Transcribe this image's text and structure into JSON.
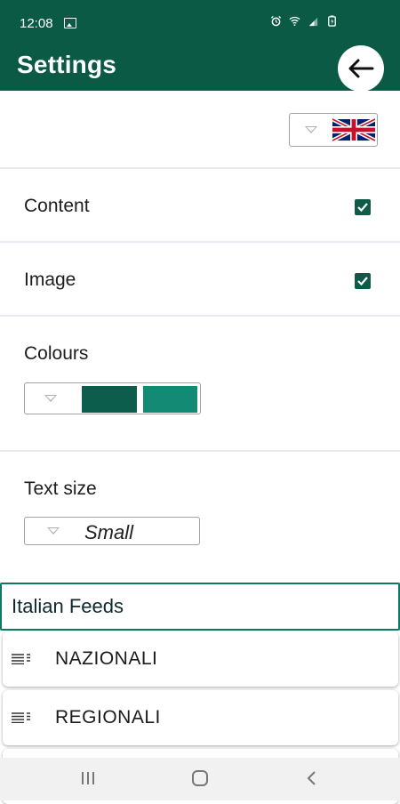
{
  "status_bar": {
    "time": "12:08",
    "icons": [
      "image-icon",
      "alarm-icon",
      "wifi-icon",
      "signal-icon",
      "battery-icon"
    ]
  },
  "app_bar": {
    "title": "Settings",
    "back_icon": "arrow-left-icon"
  },
  "language": {
    "selected_flag": "uk-flag"
  },
  "settings": {
    "content_label": "Content",
    "content_checked": true,
    "image_label": "Image",
    "image_checked": true,
    "colours_label": "Colours",
    "colours_selected": [
      "#0d5d4d",
      "#138a74"
    ],
    "text_size_label": "Text size",
    "text_size_value": "Small"
  },
  "feeds": {
    "header": "Italian Feeds",
    "items": [
      {
        "label": "NAZIONALI",
        "icon": "list-icon"
      },
      {
        "label": "REGIONALI",
        "icon": "list-icon"
      }
    ]
  },
  "nav_bar": {
    "buttons": [
      "recents-icon",
      "home-icon",
      "back-nav-icon"
    ]
  },
  "colors": {
    "primary": "#0b5a45",
    "accent": "#0e7862"
  }
}
